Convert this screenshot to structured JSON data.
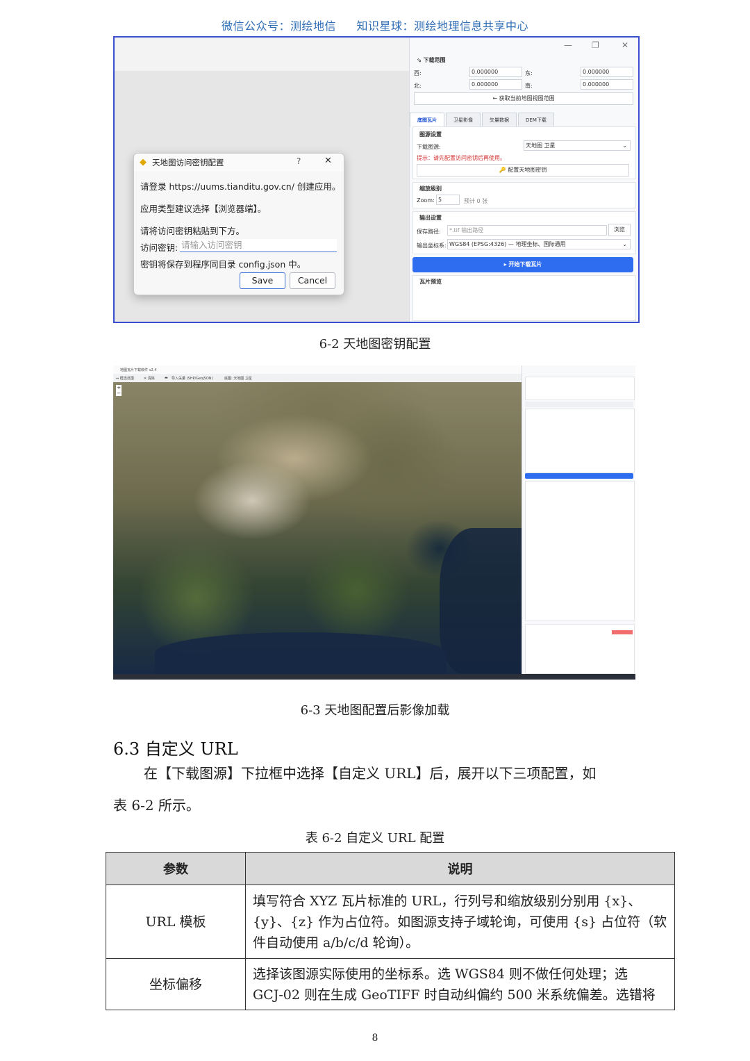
{
  "header": {
    "left": "微信公众号：测绘地信",
    "right": "知识星球：测绘地理信息共享中心"
  },
  "shot1": {
    "section": "下载范围",
    "west_label": "西:",
    "west_value": "0.000000",
    "east_label": "东:",
    "east_value": "0.000000",
    "north_label": "北:",
    "north_value": "0.000000",
    "south_label": "南:",
    "south_value": "0.000000",
    "get_view_btn": "← 获取当前地图视图范围",
    "tabs": [
      "底图瓦片",
      "卫星影像",
      "矢量数据",
      "DEM下载"
    ],
    "source_section": "图源设置",
    "source_label": "下载图源:",
    "source_value": "天地图 卫星",
    "hint": "提示：请先配置访问密钥后再使用。",
    "config_btn": "配置天地图密钥",
    "zoom_section": "缩放级别",
    "zoom_label": "Zoom:",
    "zoom_value": "5",
    "zoom_estimate": "预计 0 张",
    "output_section": "输出设置",
    "save_label": "保存路径:",
    "save_placeholder": "*.tif 输出路径",
    "browse_btn": "浏览",
    "crs_label": "输出坐标系:",
    "crs_value": "WGS84 (EPSG:4326) — 地理坐标、国际通用",
    "start_btn": "▸ 开始下载瓦片",
    "preview_section": "瓦片预览",
    "dialog": {
      "title": "天地图访问密钥配置",
      "question": "?",
      "close": "✕",
      "line1": "请登录 https://uums.tianditu.gov.cn/ 创建应用。",
      "line2": "应用类型建议选择【浏览器端】。",
      "line3": "请将访问密钥粘贴到下方。",
      "key_label": "访问密钥:",
      "key_placeholder": "请输入访问密钥",
      "line4": "密钥将保存到程序同目录 config.json 中。",
      "save": "Save",
      "cancel": "Cancel"
    }
  },
  "caption1": "6-2  天地图密钥配置",
  "shot2": {
    "title": "地图瓦片下载软件 v2.4",
    "toolbar": [
      "⇔ 框选范围",
      "✕ 清除",
      "导入矢量 (SHP/GeoJSON)",
      "底图: 天地图 卫星"
    ]
  },
  "caption2": "6-3  天地图配置后影像加载",
  "heading": "6.3 自定义 URL",
  "para1": "在【下载图源】下拉框中选择【自定义 URL】后，展开以下三项配置，如",
  "para2": "表 6-2 所示。",
  "table_caption": "表 6-2  自定义 URL 配置",
  "table": {
    "headers": [
      "参数",
      "说明"
    ],
    "rows": [
      {
        "param": "URL 模板",
        "desc1": "填写符合 XYZ 瓦片标准的 URL，行列号和缩放级别分别用 {x}、",
        "desc2": "{y}、{z} 作为占位符。如图源支持子域轮询，可使用 {s} 占位符（软",
        "desc3": "件自动使用 a/b/c/d 轮询）。"
      },
      {
        "param": "坐标偏移",
        "desc1": "选择该图源实际使用的坐标系。选 WGS84 则不做任何处理；选",
        "desc2": "GCJ-02 则在生成 GeoTIFF 时自动纠偏约 500 米系统偏差。选错将"
      }
    ]
  },
  "page_number": "8"
}
